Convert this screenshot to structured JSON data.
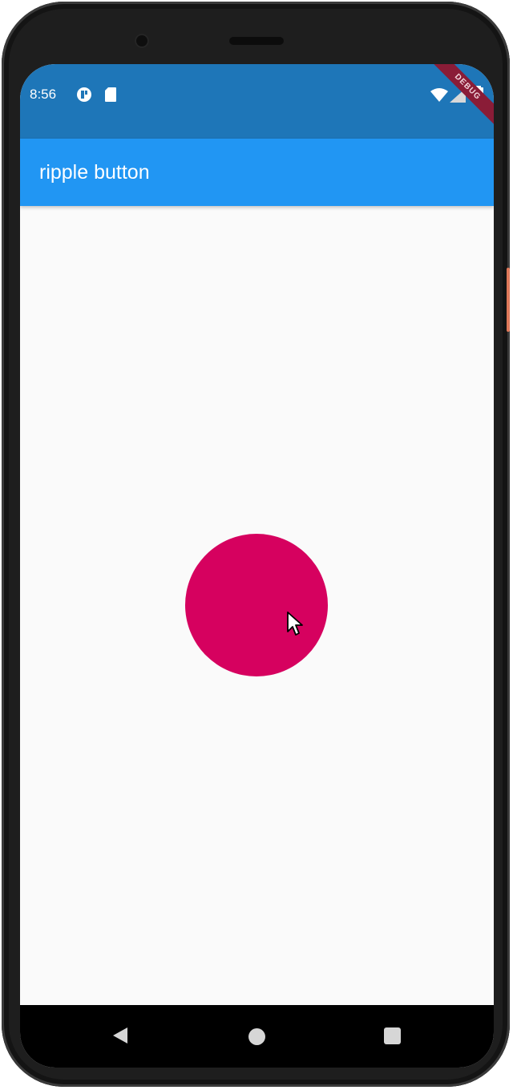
{
  "status_bar": {
    "time": "8:56",
    "icons": [
      "notification-icon",
      "sd-card-icon",
      "wifi-icon",
      "signal-icon",
      "battery-icon"
    ]
  },
  "debug_banner": {
    "label": "DEBUG"
  },
  "app_bar": {
    "title": "ripple button",
    "color": "#2196f3"
  },
  "status_bar_color": "#1e76b8",
  "main": {
    "button_shape": "circle",
    "button_color": "#d6015f"
  },
  "nav_bar": {
    "buttons": [
      "back-icon",
      "home-icon",
      "recents-icon"
    ]
  }
}
